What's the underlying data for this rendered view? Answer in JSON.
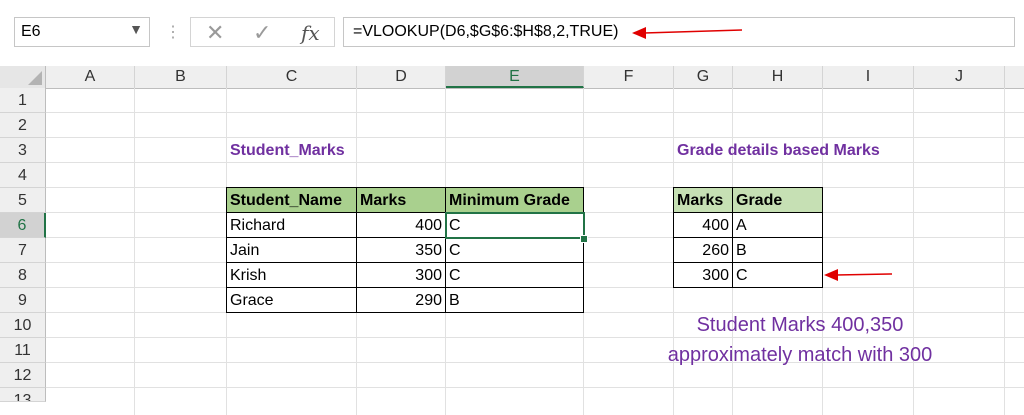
{
  "formula_bar": {
    "name_box": "E6",
    "formula": "=VLOOKUP(D6,$G$6:$H$8,2,TRUE)"
  },
  "columns": [
    "A",
    "B",
    "C",
    "D",
    "E",
    "F",
    "G",
    "H",
    "I",
    "J"
  ],
  "rows": [
    "1",
    "2",
    "3",
    "4",
    "5",
    "6",
    "7",
    "8",
    "9",
    "10",
    "11",
    "12",
    "13"
  ],
  "selected": {
    "column": "E",
    "row": "6"
  },
  "student_table": {
    "title": "Student_Marks",
    "headers": [
      "Student_Name",
      "Marks",
      "Minimum Grade"
    ],
    "rows": [
      [
        "Richard",
        "400",
        "C"
      ],
      [
        "Jain",
        "350",
        "C"
      ],
      [
        "Krish",
        "300",
        "C"
      ],
      [
        "Grace",
        "290",
        "B"
      ]
    ]
  },
  "grade_table": {
    "title": "Grade details based Marks",
    "headers": [
      "Marks",
      "Grade"
    ],
    "rows": [
      [
        "400",
        "A"
      ],
      [
        "260",
        "B"
      ],
      [
        "300",
        "C"
      ]
    ]
  },
  "note": {
    "line1": "Student Marks 400,350",
    "line2": "approximately match with 300"
  },
  "colors": {
    "arrow": "#e00000",
    "accent": "#217346",
    "title": "#7030a0",
    "header_green": "#a9d08e",
    "header_green_light": "#c6e0b4"
  }
}
